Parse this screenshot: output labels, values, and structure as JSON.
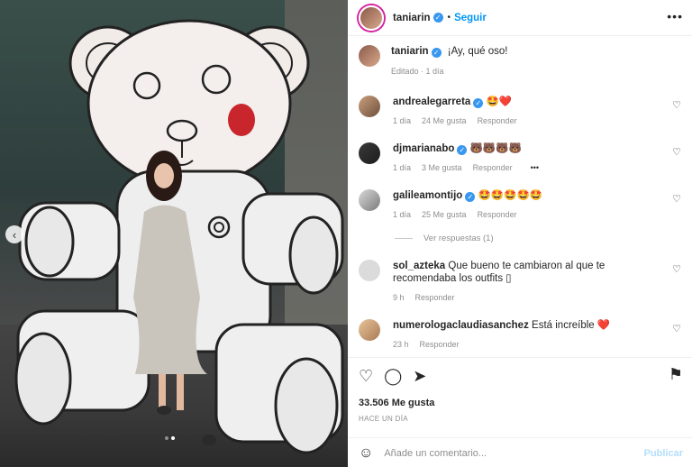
{
  "post": {
    "username": "taniarin",
    "follow_label": "Seguir",
    "separator": "•",
    "more_icon": "more-horizontal-icon"
  },
  "caption": {
    "username": "taniarin",
    "text": "¡Ay, qué oso!",
    "edited": "Editado",
    "time": "1 día"
  },
  "comments": [
    {
      "username": "andrealegarreta",
      "verified": true,
      "text": "🤩❤️",
      "time": "1 día",
      "likes": "24 Me gusta",
      "reply": "Responder"
    },
    {
      "username": "djmarianabo",
      "verified": true,
      "text": "🐻🐻🐻🐻",
      "time": "1 día",
      "likes": "3 Me gusta",
      "reply": "Responder",
      "more": "•••"
    },
    {
      "username": "galileamontijo",
      "verified": true,
      "text": "🤩🤩🤩🤩🤩",
      "time": "1 día",
      "likes": "25 Me gusta",
      "reply": "Responder"
    },
    {
      "username": "sol_azteka",
      "verified": false,
      "text": "Que bueno te cambiaron al que te recomendaba los outfits ▯",
      "time": "9 h",
      "reply": "Responder"
    },
    {
      "username": "numerologaclaudiasanchez",
      "verified": false,
      "text": "Está increíble ❤️",
      "time": "23 h",
      "reply": "Responder"
    }
  ],
  "view_replies": "Ver respuestas (1)",
  "footer": {
    "likes": "33.506 Me gusta",
    "ago": "HACE UN DÍA",
    "comment_placeholder": "Añade un comentario...",
    "publish": "Publicar"
  },
  "colors": {
    "accent": "#0095f6",
    "verified": "#3897f0",
    "heart_red": "#ed4956",
    "muted": "#8e8e8e"
  }
}
